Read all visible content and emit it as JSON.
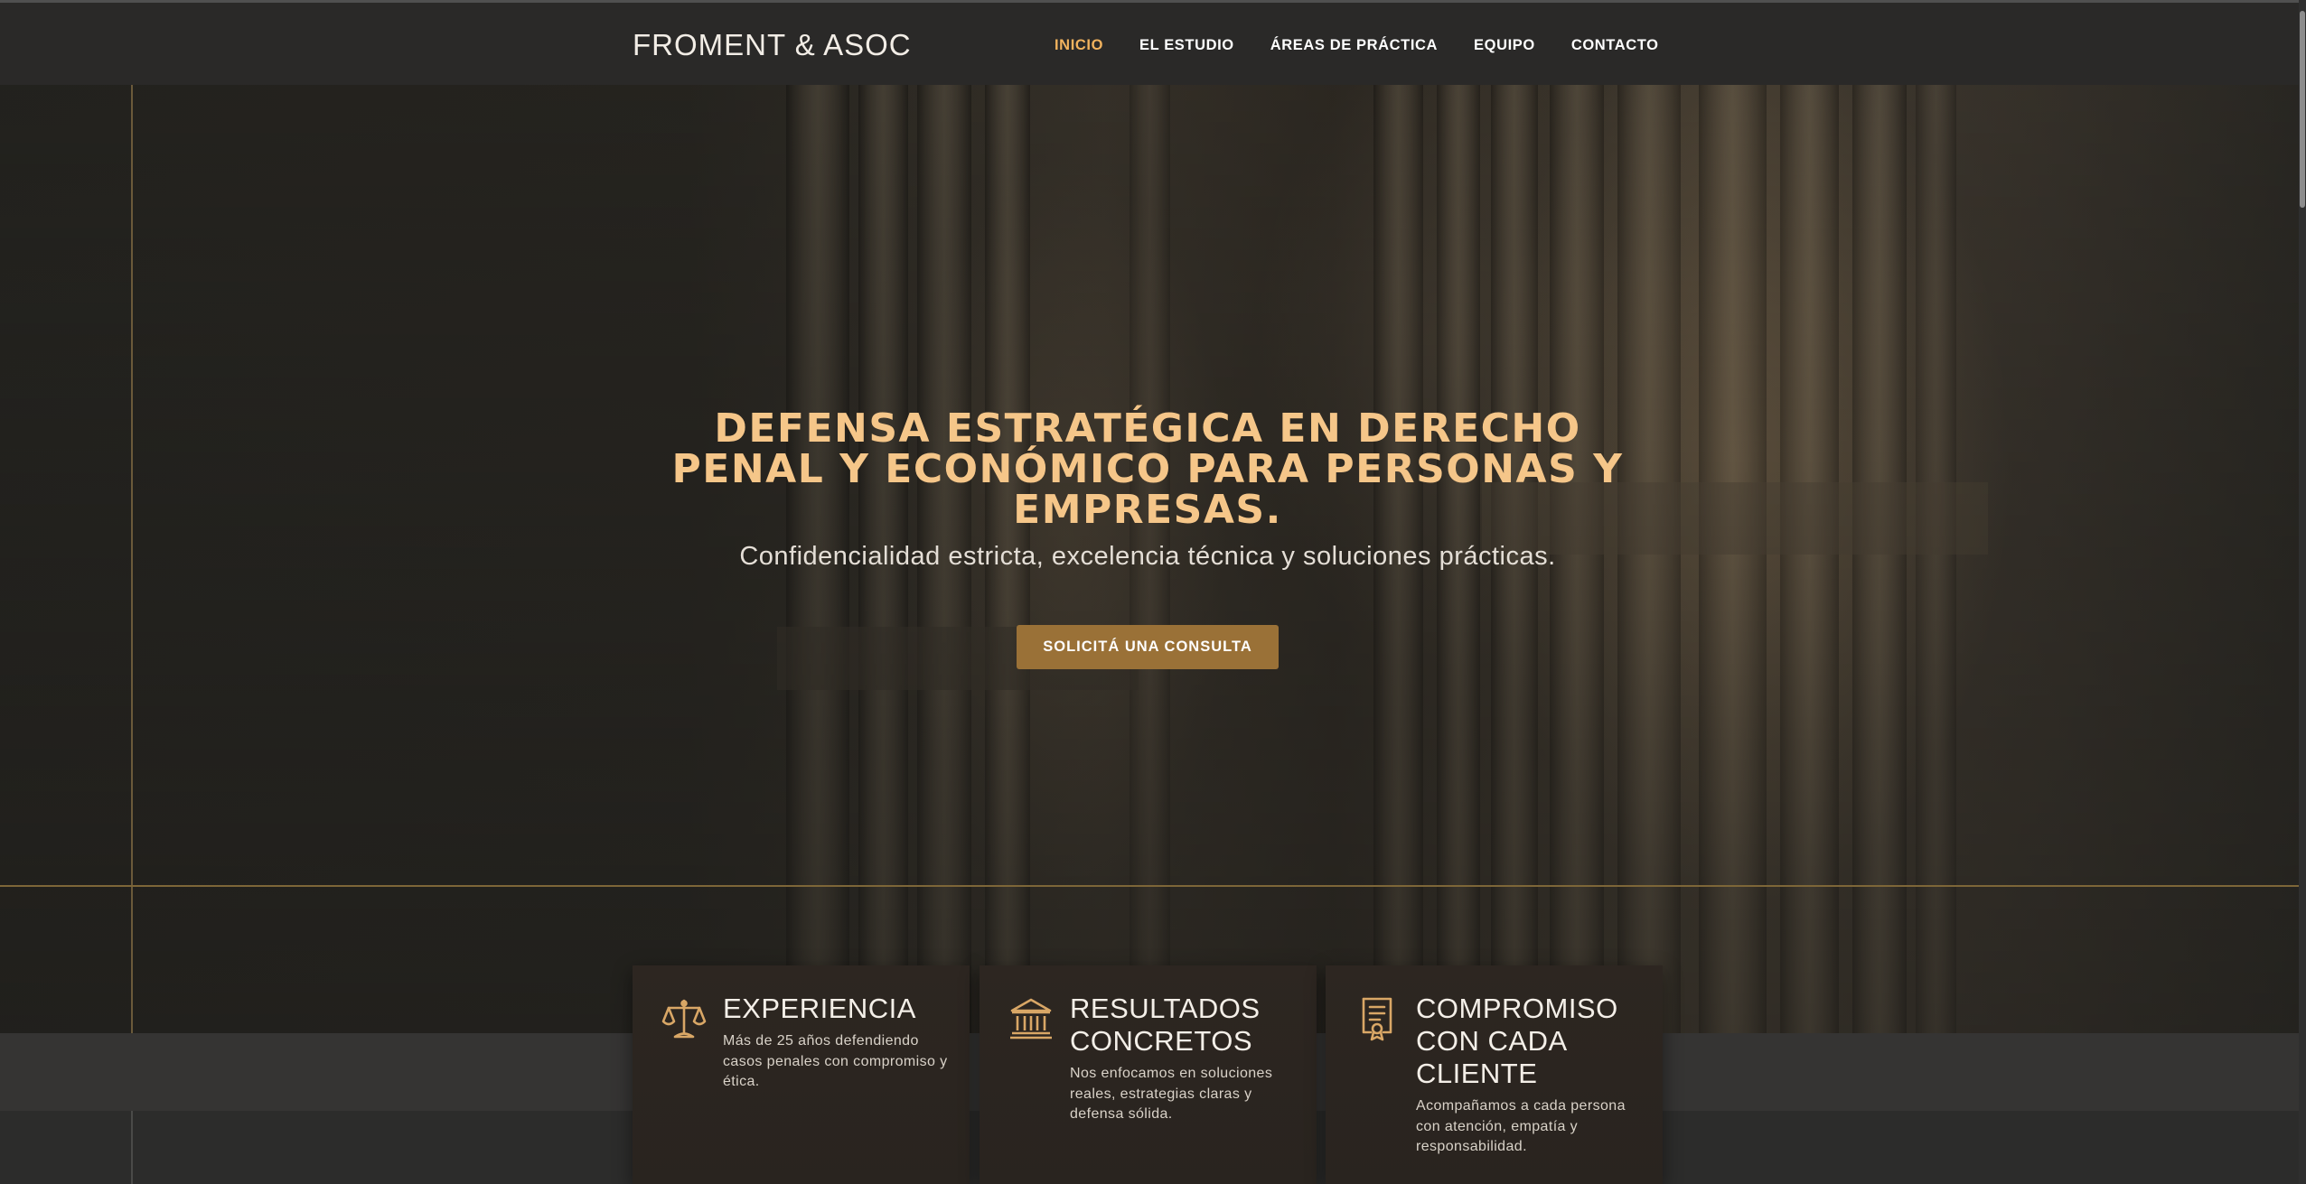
{
  "header": {
    "logo": "FROMENT & ASOC",
    "nav": [
      {
        "label": "INICIO",
        "active": true
      },
      {
        "label": "EL ESTUDIO",
        "active": false
      },
      {
        "label": "ÁREAS DE PRÁCTICA",
        "active": false
      },
      {
        "label": "EQUIPO",
        "active": false
      },
      {
        "label": "CONTACTO",
        "active": false
      }
    ]
  },
  "hero": {
    "title_lines": [
      "DEFENSA ESTRATÉGICA EN DERECHO",
      "PENAL Y ECONÓMICO PARA PERSONAS Y",
      "EMPRESAS."
    ],
    "subtitle": "Confidencialidad estricta, excelencia técnica y soluciones prácticas.",
    "cta_label": "SOLICITÁ UNA CONSULTA"
  },
  "features": [
    {
      "icon": "scales-icon",
      "title": "EXPERIENCIA",
      "text": "Más de 25 años defendiendo casos penales con compromiso y ética."
    },
    {
      "icon": "courthouse-icon",
      "title": "RESULTADOS CONCRETOS",
      "text": "Nos enfocamos en soluciones reales, estrategias claras y defensa sólida."
    },
    {
      "icon": "certificate-icon",
      "title": "COMPROMISO CON CADA CLIENTE",
      "text": "Acompañamos a cada persona con atención, empatía y responsabilidad."
    }
  ],
  "colors": {
    "accent": "#f2b35e",
    "title": "#f5c689",
    "button": "#9a7137",
    "icon": "#d9a766"
  }
}
